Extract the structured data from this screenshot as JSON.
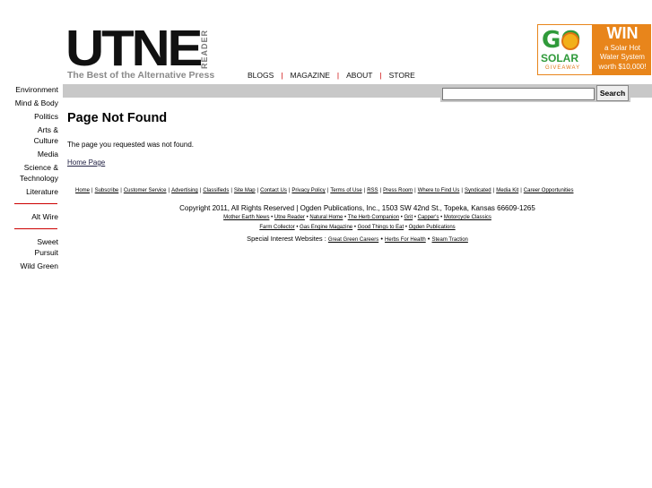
{
  "brand": {
    "logo_word": "UTNE",
    "logo_sub": "READER",
    "tagline": "The Best of the Alternative Press"
  },
  "topnav": [
    "BLOGS",
    "MAGAZINE",
    "ABOUT",
    "STORE"
  ],
  "ad": {
    "go": "GO",
    "solar": "SOLAR",
    "giveaway": "GIVEAWAY",
    "win": "WIN",
    "lines": [
      "a Solar Hot",
      "Water System",
      "worth $10,000!"
    ]
  },
  "search": {
    "button": "Search",
    "placeholder": ""
  },
  "sidebar": {
    "sections": [
      "Environment",
      "Mind & Body",
      "Politics",
      "Arts & Culture",
      "Media",
      "Science & Technology",
      "Literature"
    ],
    "alt": "Alt Wire",
    "blogs": [
      "Sweet Pursuit",
      "Wild Green"
    ]
  },
  "main": {
    "title": "Page Not Found",
    "message": "The page you requested was not found.",
    "home_link": "Home Page"
  },
  "footer": {
    "links": [
      "Home",
      "Subscribe",
      "Customer Service",
      "Advertising",
      "Classifieds",
      "Site Map",
      "Contact Us",
      "Privacy Policy",
      "Terms of Use",
      "RSS",
      "Press Room",
      "Where to Find Us",
      "Syndicated",
      "Media Kit",
      "Career Opportunities"
    ],
    "copyright": "Copyright 2011, All Rights Reserved | Ogden Publications, Inc., 1503 SW 42nd St., Topeka, Kansas 66609-1265",
    "pubs_line1": [
      "Mother Earth News",
      "Utne Reader",
      "Natural Home",
      "The Herb Companion",
      "Grit",
      "Capper's",
      "Motorcycle Classics"
    ],
    "pubs_line2": [
      "Farm Collector",
      "Gas Engine Magazine",
      "Good Things to Eat",
      "Ogden Publications"
    ],
    "special_label": "Special Interest Websites :",
    "special_links": [
      "Great Green Careers",
      "Herbs For Health",
      "Steam Traction"
    ]
  }
}
